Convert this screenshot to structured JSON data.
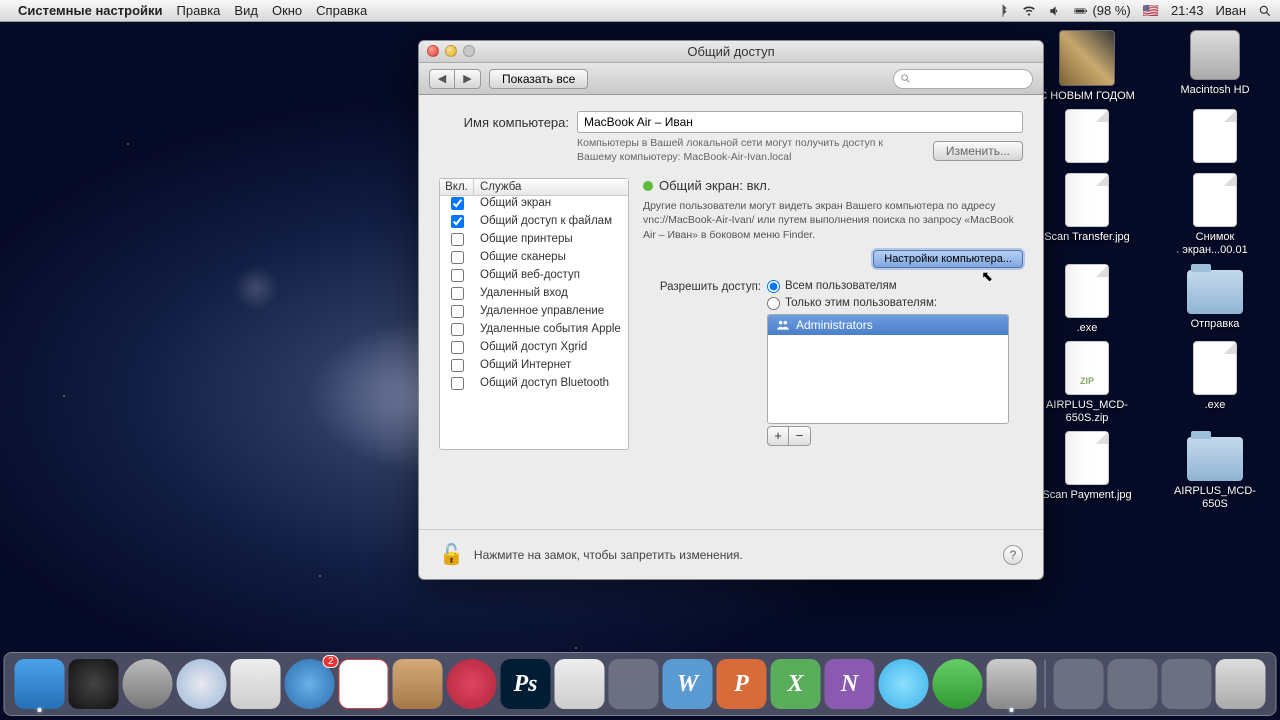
{
  "menubar": {
    "app_name": "Системные настройки",
    "menus": [
      "Правка",
      "Вид",
      "Окно",
      "Справка"
    ],
    "battery": "(98 %)",
    "flag": "🇺🇸",
    "time": "21:43",
    "user": "Иван"
  },
  "desktop_icons": [
    {
      "label": "С НОВЫМ ГОДОМ",
      "kind": "img"
    },
    {
      "label": "Macintosh HD",
      "kind": "hd"
    },
    {
      "label": "",
      "kind": "file"
    },
    {
      "label": "",
      "kind": "file"
    },
    {
      "label": "Scan Transfer.jpg",
      "kind": "file"
    },
    {
      "label": "Снимок экран...00.01",
      "kind": "file"
    },
    {
      "label": ".exe",
      "kind": "file"
    },
    {
      "label": "Отправка",
      "kind": "folder"
    },
    {
      "label": "AIRPLUS_MCD-650S.zip",
      "kind": "zip"
    },
    {
      "label": ".exe",
      "kind": "file"
    },
    {
      "label": "Scan Payment.jpg",
      "kind": "file"
    },
    {
      "label": "AIRPLUS_MCD-650S",
      "kind": "folder"
    }
  ],
  "window": {
    "title": "Общий доступ",
    "show_all": "Показать все",
    "name_label": "Имя компьютера:",
    "name_value": "MacBook Air – Иван",
    "hint": "Компьютеры в Вашей локальной сети могут получить доступ к Вашему компьютеру: MacBook-Air-Ivan.local",
    "edit_btn": "Изменить...",
    "table_head_on": "Вкл.",
    "table_head_service": "Служба",
    "services": [
      {
        "on": true,
        "label": "Общий экран"
      },
      {
        "on": true,
        "label": "Общий доступ к файлам"
      },
      {
        "on": false,
        "label": "Общие принтеры"
      },
      {
        "on": false,
        "label": "Общие сканеры"
      },
      {
        "on": false,
        "label": "Общий веб-доступ"
      },
      {
        "on": false,
        "label": "Удаленный вход"
      },
      {
        "on": false,
        "label": "Удаленное управление"
      },
      {
        "on": false,
        "label": "Удаленные события Apple"
      },
      {
        "on": false,
        "label": "Общий доступ Xgrid"
      },
      {
        "on": false,
        "label": "Общий Интернет"
      },
      {
        "on": false,
        "label": "Общий доступ Bluetooth"
      }
    ],
    "status": "Общий экран: вкл.",
    "description": "Другие пользователи могут видеть экран Вашего компьютера по адресу vnc://MacBook-Air-Ivan/ или путем выполнения поиска по запросу «MacBook Air – Иван» в боковом меню Finder.",
    "computer_settings_btn": "Настройки компьютера...",
    "allow_label": "Разрешить доступ:",
    "radio_all": "Всем пользователям",
    "radio_only": "Только этим пользователям:",
    "user_row": "Administrators",
    "lock_text": "Нажмите на замок, чтобы запретить изменения."
  },
  "dock_items": [
    "finder",
    "dashboard",
    "mission-control",
    "safari",
    "mail",
    "app-store",
    "ical",
    "address-book",
    "itunes",
    "photoshop",
    "network-utility",
    "textedit",
    "word",
    "powerpoint",
    "excel",
    "onenote",
    "skype",
    "matrix",
    "system-preferences"
  ]
}
